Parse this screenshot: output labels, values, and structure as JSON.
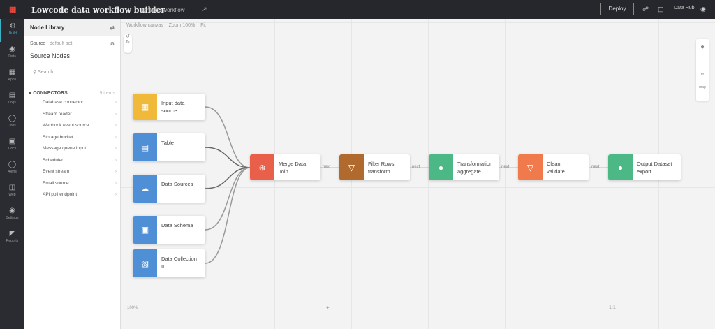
{
  "header": {
    "title": "Lowcode data workflow builder",
    "subtitle": "Untitled workflow",
    "run_label": "Deploy",
    "user": "Data Hub"
  },
  "rail": [
    {
      "label": "Build",
      "icon": "build-icon"
    },
    {
      "label": "Data",
      "icon": "data-icon"
    },
    {
      "label": "Apps",
      "icon": "apps-icon"
    },
    {
      "label": "Logs",
      "icon": "logs-icon"
    },
    {
      "label": "Jobs",
      "icon": "jobs-icon"
    },
    {
      "label": "Docs",
      "icon": "docs-icon"
    },
    {
      "label": "Alerts",
      "icon": "alerts-icon"
    },
    {
      "label": "Web",
      "icon": "web-icon"
    },
    {
      "label": "Settings",
      "icon": "settings-icon"
    },
    {
      "label": "Reports",
      "icon": "reports-icon"
    }
  ],
  "panel": {
    "header": "Node Library",
    "section": "Source",
    "section_value": "default set",
    "heading": "Source Nodes",
    "search": "Search",
    "category": "CONNECTORS",
    "category_count": "9 items",
    "items": [
      "Database connector",
      "Stream reader",
      "Webhook event source",
      "Storage bucket",
      "Message queue input",
      "Scheduler",
      "Event stream",
      "Email source",
      "API poll endpoint"
    ]
  },
  "canvas": {
    "toolbar": [
      "Workflow canvas",
      "Zoom 100%",
      "Fit"
    ],
    "footer_left": "100%",
    "footer_mid": "+",
    "footer_right": "1:1"
  },
  "sources": [
    {
      "label": "Input data",
      "sub": "source",
      "color": "#f0b93a",
      "icon": "grid-icon"
    },
    {
      "label": "Table",
      "sub": "",
      "color": "#4f8fd6",
      "icon": "table-icon"
    },
    {
      "label": "Data Sources",
      "sub": "",
      "color": "#4f8fd6",
      "icon": "cloud-icon"
    },
    {
      "label": "Data Schema",
      "sub": "",
      "color": "#4f8fd6",
      "icon": "schema-icon"
    },
    {
      "label": "Data Collection",
      "sub": "II",
      "color": "#4f8fd6",
      "icon": "collection-icon"
    }
  ],
  "pipeline": [
    {
      "label": "Merge Data",
      "sub": "Join",
      "color": "#e8604a",
      "icon": "merge-icon",
      "edge": ""
    },
    {
      "label": "Filter Rows",
      "sub": "transform",
      "color": "#b06a2e",
      "icon": "filter-icon",
      "edge": "next"
    },
    {
      "label": "Transformation",
      "sub": "aggregate",
      "color": "#4bb886",
      "icon": "user-icon",
      "edge": "next"
    },
    {
      "label": "Clean",
      "sub": "validate",
      "color": "#f07a4c",
      "icon": "filter-icon",
      "edge": "next"
    },
    {
      "label": "Output Dataset",
      "sub": "export",
      "color": "#4bb886",
      "icon": "user-icon",
      "edge": "next"
    }
  ]
}
